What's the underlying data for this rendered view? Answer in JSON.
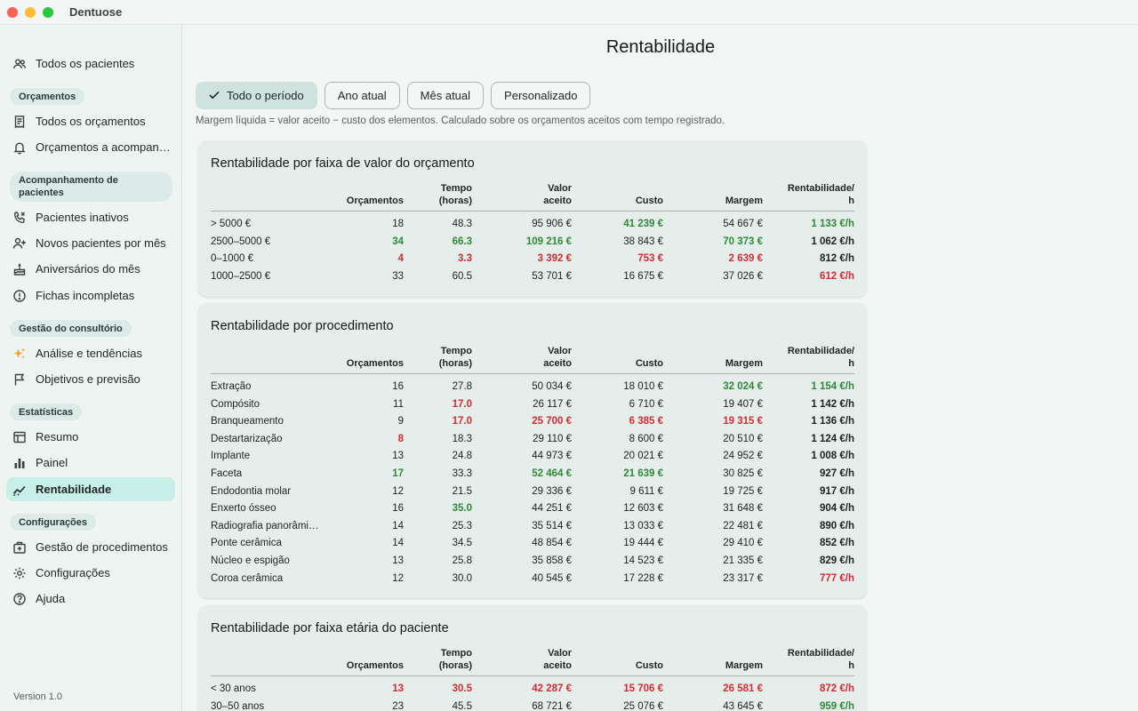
{
  "window": {
    "title": "Dentuose"
  },
  "sidebar": {
    "top_items": [
      {
        "label": "Todos os pacientes",
        "icon": "people-icon"
      }
    ],
    "sections": [
      {
        "title": "Orçamentos",
        "items": [
          {
            "label": "Todos os orçamentos",
            "icon": "receipt-icon"
          },
          {
            "label": "Orçamentos a acompanh…",
            "icon": "bell-icon"
          }
        ]
      },
      {
        "title": "Acompanhamento de pacientes",
        "items": [
          {
            "label": "Pacientes inativos",
            "icon": "phone-icon"
          },
          {
            "label": "Novos pacientes por mês",
            "icon": "person-add-icon"
          },
          {
            "label": "Aniversários do mês",
            "icon": "cake-icon"
          },
          {
            "label": "Fichas incompletas",
            "icon": "alert-circle-icon"
          }
        ]
      },
      {
        "title": "Gestão do consultório",
        "items": [
          {
            "label": "Análise e tendências",
            "icon": "sparkle-icon"
          },
          {
            "label": "Objetivos e previsão",
            "icon": "flag-icon"
          }
        ]
      },
      {
        "title": "Estatísticas",
        "items": [
          {
            "label": "Resumo",
            "icon": "table-icon"
          },
          {
            "label": "Painel",
            "icon": "bar-chart-icon"
          },
          {
            "label": "Rentabilidade",
            "icon": "trend-icon",
            "active": true
          }
        ]
      },
      {
        "title": "Configurações",
        "items": [
          {
            "label": "Gestão de procedimentos",
            "icon": "medical-box-icon"
          },
          {
            "label": "Configurações",
            "icon": "gear-icon"
          },
          {
            "label": "Ajuda",
            "icon": "help-icon"
          }
        ]
      }
    ],
    "version": "Version 1.0"
  },
  "main": {
    "title": "Rentabilidade",
    "filters": [
      {
        "label": "Todo o período",
        "selected": true
      },
      {
        "label": "Ano atual",
        "selected": false
      },
      {
        "label": "Mês atual",
        "selected": false
      },
      {
        "label": "Personalizado",
        "selected": false
      }
    ],
    "note": "Margem líquida = valor aceito − custo dos elementos. Calculado sobre os orçamentos aceitos com tempo registrado.",
    "headers": [
      "",
      "Orçamentos",
      "Tempo\n(horas)",
      "Valor\naceito",
      "Custo",
      "Margem",
      "Rentabilidade/\nh"
    ],
    "tables": [
      {
        "title": "Rentabilidade por faixa de valor do orçamento",
        "rows": [
          {
            "cells": [
              "> 5000 €",
              "18",
              "48.3",
              "95 906 €",
              "41 239 €",
              "54 667 €",
              "1 133 €/h"
            ],
            "styles": [
              "",
              "",
              "",
              "",
              "g",
              "",
              "g"
            ]
          },
          {
            "cells": [
              "2500–5000 €",
              "34",
              "66.3",
              "109 216 €",
              "38 843 €",
              "70 373 €",
              "1 062 €/h"
            ],
            "styles": [
              "",
              "g",
              "g",
              "g",
              "",
              "g",
              ""
            ]
          },
          {
            "cells": [
              "0–1000 €",
              "4",
              "3.3",
              "3 392 €",
              "753 €",
              "2 639 €",
              "812 €/h"
            ],
            "styles": [
              "",
              "r",
              "r",
              "r",
              "r",
              "r",
              ""
            ]
          },
          {
            "cells": [
              "1000–2500 €",
              "33",
              "60.5",
              "53 701 €",
              "16 675 €",
              "37 026 €",
              "612 €/h"
            ],
            "styles": [
              "",
              "",
              "",
              "",
              "",
              "",
              "r"
            ]
          }
        ]
      },
      {
        "title": "Rentabilidade por procedimento",
        "rows": [
          {
            "cells": [
              "Extração",
              "16",
              "27.8",
              "50 034 €",
              "18 010 €",
              "32 024 €",
              "1 154 €/h"
            ],
            "styles": [
              "",
              "",
              "",
              "",
              "",
              "g",
              "g"
            ]
          },
          {
            "cells": [
              "Compósito",
              "11",
              "17.0",
              "26 117 €",
              "6 710 €",
              "19 407 €",
              "1 142 €/h"
            ],
            "styles": [
              "",
              "",
              "r",
              "",
              "",
              "",
              ""
            ]
          },
          {
            "cells": [
              "Branqueamento",
              "9",
              "17.0",
              "25 700 €",
              "6 385 €",
              "19 315 €",
              "1 136 €/h"
            ],
            "styles": [
              "",
              "",
              "r",
              "r",
              "r",
              "r",
              ""
            ]
          },
          {
            "cells": [
              "Destartarização",
              "8",
              "18.3",
              "29 110 €",
              "8 600 €",
              "20 510 €",
              "1 124 €/h"
            ],
            "styles": [
              "",
              "r",
              "",
              "",
              "",
              "",
              ""
            ]
          },
          {
            "cells": [
              "Implante",
              "13",
              "24.8",
              "44 973 €",
              "20 021 €",
              "24 952 €",
              "1 008 €/h"
            ],
            "styles": [
              "",
              "",
              "",
              "",
              "",
              "",
              ""
            ]
          },
          {
            "cells": [
              "Faceta",
              "17",
              "33.3",
              "52 464 €",
              "21 639 €",
              "30 825 €",
              "927 €/h"
            ],
            "styles": [
              "",
              "g",
              "",
              "g",
              "g",
              "",
              ""
            ]
          },
          {
            "cells": [
              "Endodontia molar",
              "12",
              "21.5",
              "29 336 €",
              "9 611 €",
              "19 725 €",
              "917 €/h"
            ],
            "styles": [
              "",
              "",
              "",
              "",
              "",
              "",
              ""
            ]
          },
          {
            "cells": [
              "Enxerto ósseo",
              "16",
              "35.0",
              "44 251 €",
              "12 603 €",
              "31 648 €",
              "904 €/h"
            ],
            "styles": [
              "",
              "",
              "g",
              "",
              "",
              "",
              ""
            ]
          },
          {
            "cells": [
              "Radiografia panorâmi…",
              "14",
              "25.3",
              "35 514 €",
              "13 033 €",
              "22 481 €",
              "890 €/h"
            ],
            "styles": [
              "",
              "",
              "",
              "",
              "",
              "",
              ""
            ]
          },
          {
            "cells": [
              "Ponte cerâmica",
              "14",
              "34.5",
              "48 854 €",
              "19 444 €",
              "29 410 €",
              "852 €/h"
            ],
            "styles": [
              "",
              "",
              "",
              "",
              "",
              "",
              ""
            ]
          },
          {
            "cells": [
              "Núcleo e espigão",
              "13",
              "25.8",
              "35 858 €",
              "14 523 €",
              "21 335 €",
              "829 €/h"
            ],
            "styles": [
              "",
              "",
              "",
              "",
              "",
              "",
              ""
            ]
          },
          {
            "cells": [
              "Coroa cerâmica",
              "12",
              "30.0",
              "40 545 €",
              "17 228 €",
              "23 317 €",
              "777 €/h"
            ],
            "styles": [
              "",
              "",
              "",
              "",
              "",
              "",
              "r"
            ]
          }
        ]
      },
      {
        "title": "Rentabilidade por faixa etária do paciente",
        "rows": [
          {
            "cells": [
              "< 30 anos",
              "13",
              "30.5",
              "42 287 €",
              "15 706 €",
              "26 581 €",
              "872 €/h"
            ],
            "styles": [
              "",
              "r",
              "r",
              "r",
              "r",
              "r",
              "r"
            ]
          },
          {
            "cells": [
              "30–50 anos",
              "23",
              "45.5",
              "68 721 €",
              "25 076 €",
              "43 645 €",
              "959 €/h"
            ],
            "styles": [
              "",
              "",
              "",
              "",
              "",
              "",
              "g"
            ]
          }
        ]
      }
    ]
  },
  "colors": {
    "accent_active": "#c9f0e8",
    "positive": "#2e8a36",
    "negative": "#d62b30"
  }
}
